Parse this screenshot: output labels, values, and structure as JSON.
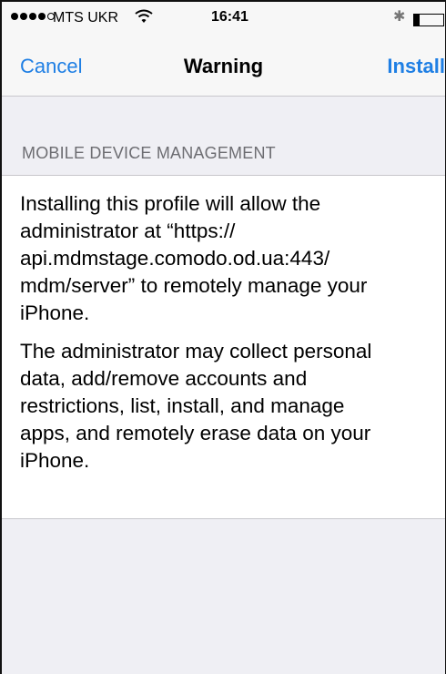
{
  "status_bar": {
    "carrier": "MTS UKR",
    "time": "16:41",
    "signal_bars_filled": 4,
    "signal_bars_total": 5,
    "battery_level": 0.2
  },
  "nav": {
    "cancel_label": "Cancel",
    "title": "Warning",
    "install_label": "Install"
  },
  "section": {
    "header": "MOBILE DEVICE MANAGEMENT",
    "paragraph_1": "Installing this profile will allow the\nadministrator at “https://\napi.mdmstage.comodo.od.ua:443/\nmdm/server” to remotely manage your\niPhone.",
    "paragraph_2": "The administrator may collect personal\ndata, add/remove accounts and\nrestrictions, list, install, and manage\napps, and remotely erase data on your\niPhone."
  },
  "colors": {
    "accent": "#1f7fe4",
    "grouped_background": "#efeff4",
    "section_header_text": "#6d6d72"
  },
  "icons": [
    "signal-dots-icon",
    "wifi-icon",
    "bluetooth-icon",
    "battery-icon"
  ]
}
